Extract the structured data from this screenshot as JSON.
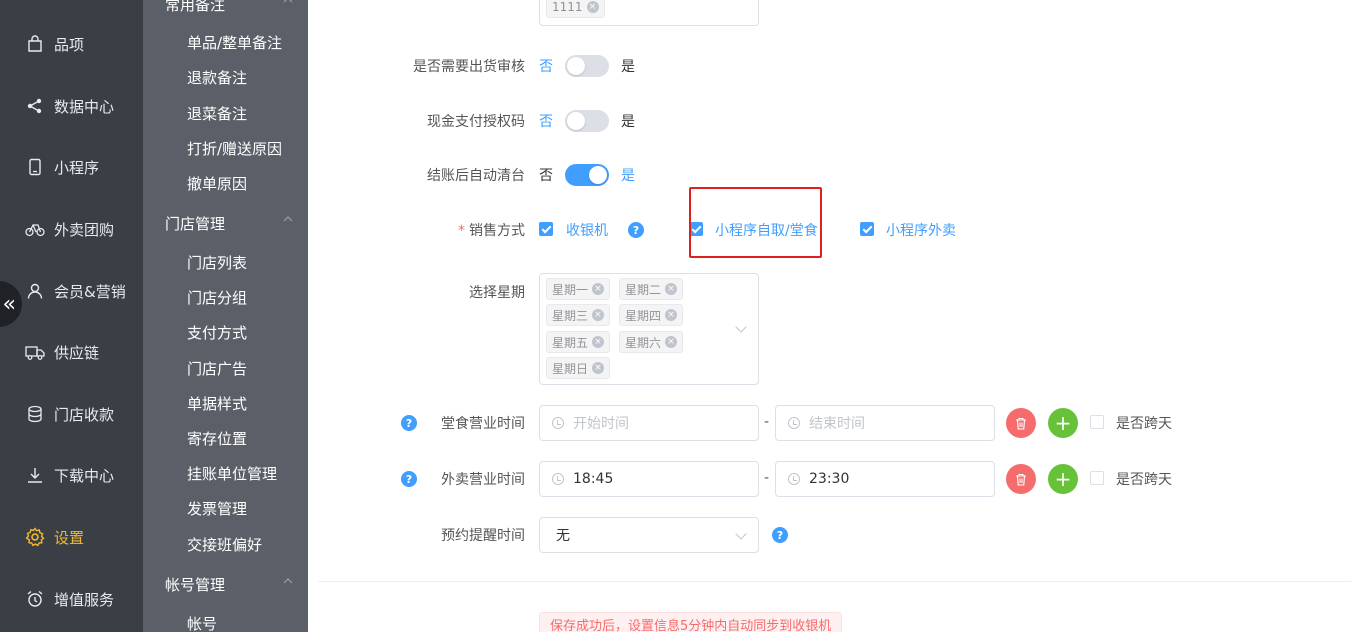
{
  "nav": {
    "items": [
      {
        "label": "品项",
        "icon": "bag-icon",
        "active": false
      },
      {
        "label": "数据中心",
        "icon": "share-icon",
        "active": false
      },
      {
        "label": "小程序",
        "icon": "phone-icon",
        "active": false
      },
      {
        "label": "外卖团购",
        "icon": "bicycle-icon",
        "active": false
      },
      {
        "label": "会员&营销",
        "icon": "user-icon",
        "active": false
      },
      {
        "label": "供应链",
        "icon": "truck-icon",
        "active": false
      },
      {
        "label": "门店收款",
        "icon": "database-icon",
        "active": false
      },
      {
        "label": "下载中心",
        "icon": "download-icon",
        "active": false
      },
      {
        "label": "设置",
        "icon": "gear-icon",
        "active": true
      },
      {
        "label": "增值服务",
        "icon": "alarm-clock-icon",
        "active": false
      }
    ],
    "collapse_glyph": "«",
    "active_color": "#f5b82e"
  },
  "subnav": {
    "groups": [
      {
        "title": "常用备注",
        "items": [
          "单品/整单备注",
          "退款备注",
          "退菜备注",
          "打折/赠送原因",
          "撤单原因"
        ]
      },
      {
        "title": "门店管理",
        "items": [
          "门店列表",
          "门店分组",
          "支付方式",
          "门店广告",
          "单据样式",
          "寄存位置",
          "挂账单位管理",
          "发票管理",
          "交接班偏好"
        ]
      },
      {
        "title": "帐号管理",
        "items": [
          "帐号"
        ]
      }
    ]
  },
  "form": {
    "top_tag": "1111",
    "shipping_review": {
      "label": "是否需要出货审核",
      "off": "否",
      "on": "是",
      "value": false
    },
    "cash_auth": {
      "label": "现金支付授权码",
      "off": "否",
      "on": "是",
      "value": false
    },
    "auto_clear": {
      "label": "结账后自动清台",
      "off": "否",
      "on": "是",
      "value": true
    },
    "sales_mode": {
      "label": "销售方式",
      "required_mark": "*",
      "options": [
        {
          "label": "收银机",
          "checked": true
        },
        {
          "label": "小程序自取/堂食",
          "checked": true
        },
        {
          "label": "小程序外卖",
          "checked": true
        }
      ]
    },
    "weekdays": {
      "label": "选择星期",
      "tags": [
        "星期一",
        "星期二",
        "星期三",
        "星期四",
        "星期五",
        "星期六",
        "星期日"
      ]
    },
    "dine_in_hours": {
      "label": "堂食营业时间",
      "start_placeholder": "开始时间",
      "end_placeholder": "结束时间",
      "separator": "-",
      "cross_day_label": "是否跨天",
      "cross_day": false
    },
    "delivery_hours": {
      "label": "外卖营业时间",
      "start": "18:45",
      "end": "23:30",
      "separator": "-",
      "cross_day_label": "是否跨天",
      "cross_day": false
    },
    "reminder": {
      "label": "预约提醒时间",
      "value": "无"
    },
    "help_glyph": "?",
    "delete_glyph": "🗑",
    "add_glyph": "+",
    "remove_glyph": "×",
    "save_tip": "保存成功后，设置信息5分钟内自动同步到收银机"
  },
  "colors": {
    "primary": "#409eff",
    "danger": "#f56c6c",
    "success": "#67c23a",
    "highlight_box": "#e02020"
  }
}
